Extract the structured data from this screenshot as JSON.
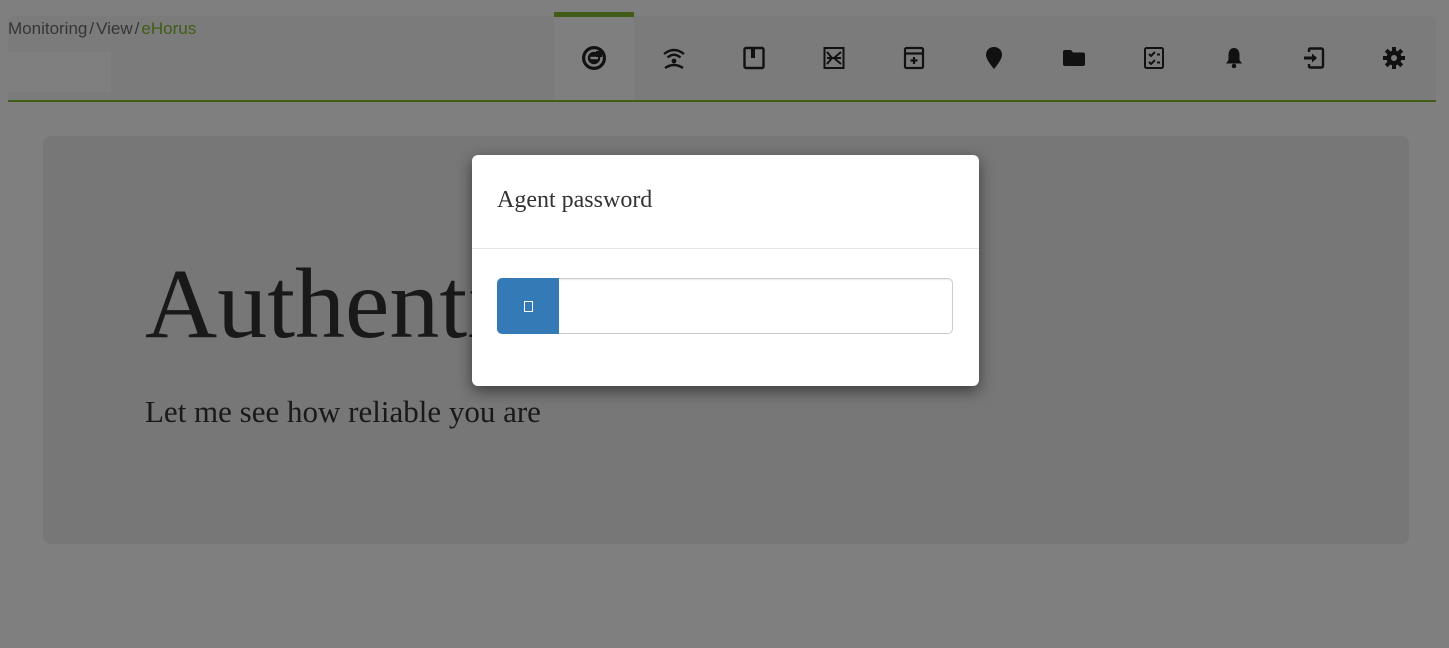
{
  "breadcrumb": {
    "items": [
      "Monitoring",
      "View",
      "eHorus"
    ],
    "separator": "/"
  },
  "toolbar": {
    "tabs": [
      {
        "icon": "ehorus-icon",
        "active": true
      },
      {
        "icon": "wifi-icon",
        "active": false
      },
      {
        "icon": "bookmark-icon",
        "active": false
      },
      {
        "icon": "chart-icon",
        "active": false
      },
      {
        "icon": "archive-icon",
        "active": false
      },
      {
        "icon": "map-marker-icon",
        "active": false
      },
      {
        "icon": "folder-icon",
        "active": false
      },
      {
        "icon": "checklist-icon",
        "active": false
      },
      {
        "icon": "bell-icon",
        "active": false
      },
      {
        "icon": "login-icon",
        "active": false
      },
      {
        "icon": "gear-icon",
        "active": false
      }
    ]
  },
  "jumbotron": {
    "title": "Authentication",
    "subtitle": "Let me see how reliable you are"
  },
  "modal": {
    "title": "Agent password",
    "password_value": ""
  },
  "colors": {
    "accent": "#82b92e",
    "primary_button": "#337ab7",
    "overlay": "rgba(0,0,0,0.5)"
  }
}
